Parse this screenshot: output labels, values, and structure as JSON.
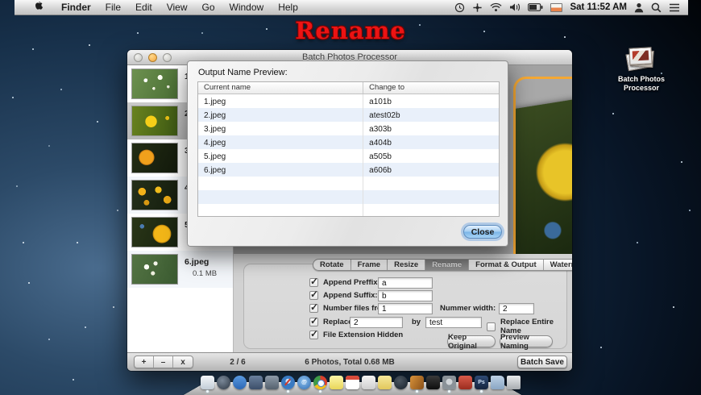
{
  "menu_bar": {
    "app_menu": "Finder",
    "items": [
      "File",
      "Edit",
      "View",
      "Go",
      "Window",
      "Help"
    ],
    "status": {
      "clock_label": "Sat 11:52 AM",
      "icons": [
        "time-machine-icon",
        "accessibility-icon",
        "wifi-icon",
        "volume-icon",
        "battery-icon",
        "input-source-flag-icon",
        "user-icon",
        "spotlight-icon",
        "notification-list-icon"
      ]
    }
  },
  "desktop": {
    "wallpaper_title": "Rename",
    "icon_label": "Batch Photos Processor"
  },
  "window": {
    "title": "Batch Photos Processor",
    "sidebar": {
      "items": [
        {
          "name": "1.jpeg",
          "size": "",
          "thumb": "t1",
          "selected": false
        },
        {
          "name": "2.jpeg",
          "size": "",
          "thumb": "t2",
          "selected": true
        },
        {
          "name": "3.jpeg",
          "size": "",
          "thumb": "t3",
          "selected": false
        },
        {
          "name": "4.jpeg",
          "size": "",
          "thumb": "t4",
          "selected": false
        },
        {
          "name": "5.jpeg",
          "size": "",
          "thumb": "t5",
          "selected": false
        },
        {
          "name": "6.jpeg",
          "size": "0.1 MB",
          "thumb": "t6",
          "selected": false
        }
      ]
    },
    "preview_accent_color": "#f5a833",
    "tabs": [
      "Rotate",
      "Frame",
      "Resize",
      "Rename",
      "Format & Output",
      "Watermark"
    ],
    "active_tab": "Rename",
    "rename_panel": {
      "append_prefix": {
        "label": "Append Preffix:",
        "checked": true,
        "value": "a"
      },
      "append_suffix": {
        "label": "Append Suffix:",
        "checked": true,
        "value": "b"
      },
      "number_from": {
        "label": "Number files from:",
        "checked": true,
        "value": "1"
      },
      "number_width": {
        "label": "Nummer width:",
        "value": "2"
      },
      "replace": {
        "label": "Replace",
        "checked": true,
        "find": "2",
        "by_label": "by",
        "with": "test"
      },
      "replace_entire": {
        "label": "Replace Entire Name",
        "checked": false
      },
      "ext_hidden": {
        "label": "File Extension Hidden",
        "checked": true
      },
      "keep_original_label": "Keep Original",
      "preview_naming_label": "Preview Naming"
    },
    "bottom_bar": {
      "add_label": "+",
      "remove_label": "–",
      "clear_label": "x",
      "position": "2 / 6",
      "summary": "6 Photos, Total 0.68 MB",
      "batch_save_label": "Batch Save"
    }
  },
  "dialog": {
    "title": "Output Name Preview:",
    "table": {
      "columns": [
        "Current name",
        "Change to"
      ],
      "rows": [
        [
          "1.jpeg",
          "a101b"
        ],
        [
          "2.jpeg",
          "atest02b"
        ],
        [
          "3.jpeg",
          "a303b"
        ],
        [
          "4.jpeg",
          "a404b"
        ],
        [
          "5.jpeg",
          "a505b"
        ],
        [
          "6.jpeg",
          "a606b"
        ]
      ],
      "empty_rows": 3,
      "row_alt_color": "#e9f0fa"
    },
    "close_label": "Close"
  },
  "dock": {
    "apps": [
      {
        "name": "textedit",
        "glyph": "",
        "running": true
      },
      {
        "name": "launchpad",
        "glyph": "",
        "running": false
      },
      {
        "name": "appstore",
        "glyph": "",
        "running": false
      },
      {
        "name": "mail",
        "glyph": "",
        "running": false
      },
      {
        "name": "preview",
        "glyph": "",
        "running": false
      },
      {
        "name": "safari",
        "glyph": "",
        "running": true
      },
      {
        "name": "atmail",
        "glyph": "@",
        "running": false
      },
      {
        "name": "chrome",
        "glyph": "",
        "running": true
      },
      {
        "name": "stickies",
        "glyph": "",
        "running": false
      },
      {
        "name": "calendar",
        "glyph": "22",
        "running": false
      },
      {
        "name": "reminders",
        "glyph": "",
        "running": false
      },
      {
        "name": "notes",
        "glyph": "",
        "running": false
      },
      {
        "name": "quicktime",
        "glyph": "",
        "running": false
      },
      {
        "name": "photos",
        "glyph": "",
        "running": true
      },
      {
        "name": "terminal",
        "glyph": "",
        "running": false
      },
      {
        "name": "prefs",
        "glyph": "",
        "running": true
      },
      {
        "name": "redapp",
        "glyph": "",
        "running": false
      },
      {
        "name": "photoshop",
        "glyph": "Ps",
        "running": true
      },
      {
        "name": "folder",
        "glyph": "",
        "running": false
      },
      {
        "name": "trash",
        "glyph": "",
        "running": false
      }
    ]
  }
}
